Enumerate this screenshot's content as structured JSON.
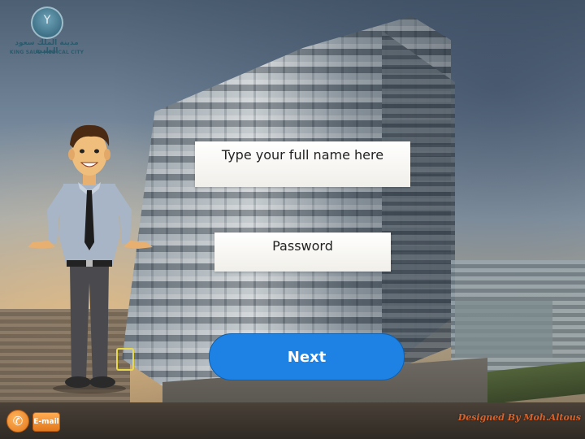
{
  "logo": {
    "mark_glyph": "Y",
    "arabic_name": "مدينة الملك سعود الطبية",
    "english_name": "KING SAUD MEDICAL CITY"
  },
  "form": {
    "name_placeholder": "Type your full name here",
    "password_placeholder": "Password",
    "next_label": "Next"
  },
  "footer": {
    "phone_icon": "phone-icon",
    "phone_glyph": "✆",
    "email_label": "E-mail",
    "credit": "Designed By Moh.Altous"
  },
  "colors": {
    "next_button": "#1e82e4",
    "contact_orange": "#e3781c",
    "credit_text": "#d9622b"
  }
}
